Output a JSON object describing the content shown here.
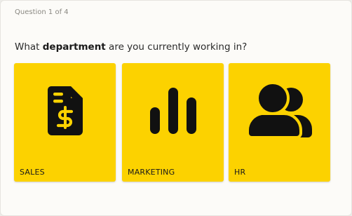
{
  "progress": "Question 1 of 4",
  "question": {
    "prefix": "What ",
    "emphasis": "department",
    "suffix": " are you currently working in?"
  },
  "options": [
    {
      "label": "SALES",
      "icon": "invoice-dollar-icon"
    },
    {
      "label": "MARKETING",
      "icon": "bar-chart-icon"
    },
    {
      "label": "HR",
      "icon": "users-icon"
    }
  ],
  "colors": {
    "option_bg": "#fcd200",
    "icon": "#111111",
    "card_bg": "#fcfbf8"
  }
}
